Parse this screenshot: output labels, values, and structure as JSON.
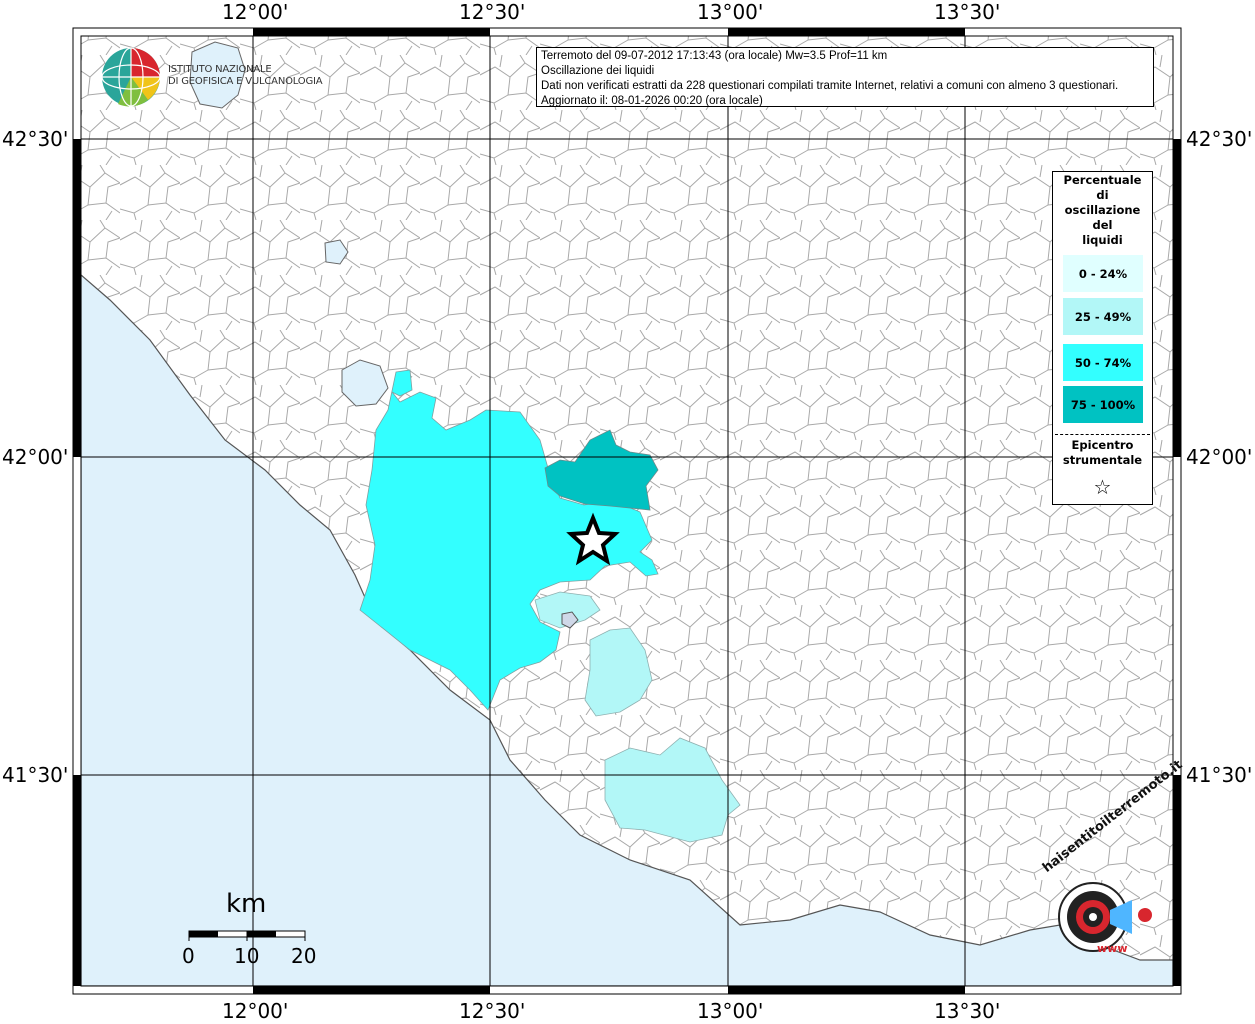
{
  "map": {
    "top_ticks": [
      "12°00'",
      "12°30'",
      "13°00'",
      "13°30'"
    ],
    "bottom_ticks": [
      "12°00'",
      "12°30'",
      "13°00'",
      "13°30'"
    ],
    "left_ticks": [
      "42°30'",
      "42°00'",
      "41°30'"
    ],
    "right_ticks": [
      "42°30'",
      "42°00'",
      "41°30'"
    ]
  },
  "info": {
    "line1": "Terremoto del 09-07-2012 17:13:43 (ora locale) Mw=3.5 Prof=11 km",
    "line2": "Oscillazione dei liquidi",
    "line3": "Dati non verificati estratti da 228 questionari compilati tramite Internet, relativi a comuni con almeno 3 questionari.",
    "line4": "Aggiornato il: 08-01-2026 00:20 (ora locale)"
  },
  "logo": {
    "line1": "ISTITUTO NAZIONALE",
    "line2": "DI GEOFISICA E VULCANOLOGIA"
  },
  "legend": {
    "title_lines": [
      "Percentuale",
      "di",
      "oscillazione",
      "del",
      "liquidi"
    ],
    "classes": [
      {
        "label": "0 - 24%",
        "color": "#e0ffff"
      },
      {
        "label": "25 - 49%",
        "color": "#b2f7f7"
      },
      {
        "label": "50 - 74%",
        "color": "#33ffff"
      },
      {
        "label": "75 - 100%",
        "color": "#00c2c2"
      }
    ],
    "epicenter_line1": "Epicentro",
    "epicenter_line2": "strumentale",
    "epicenter_symbol": "☆"
  },
  "scale": {
    "unit": "km",
    "labels": [
      "0",
      "10",
      "20"
    ]
  },
  "badge": {
    "text_top": "haisentitoilterremoto.it",
    "text_bottom": "www"
  },
  "colors": {
    "sea": "#dff1fb",
    "land": "#ffffff",
    "grid": "#000000",
    "border": "#9a9a9a"
  }
}
